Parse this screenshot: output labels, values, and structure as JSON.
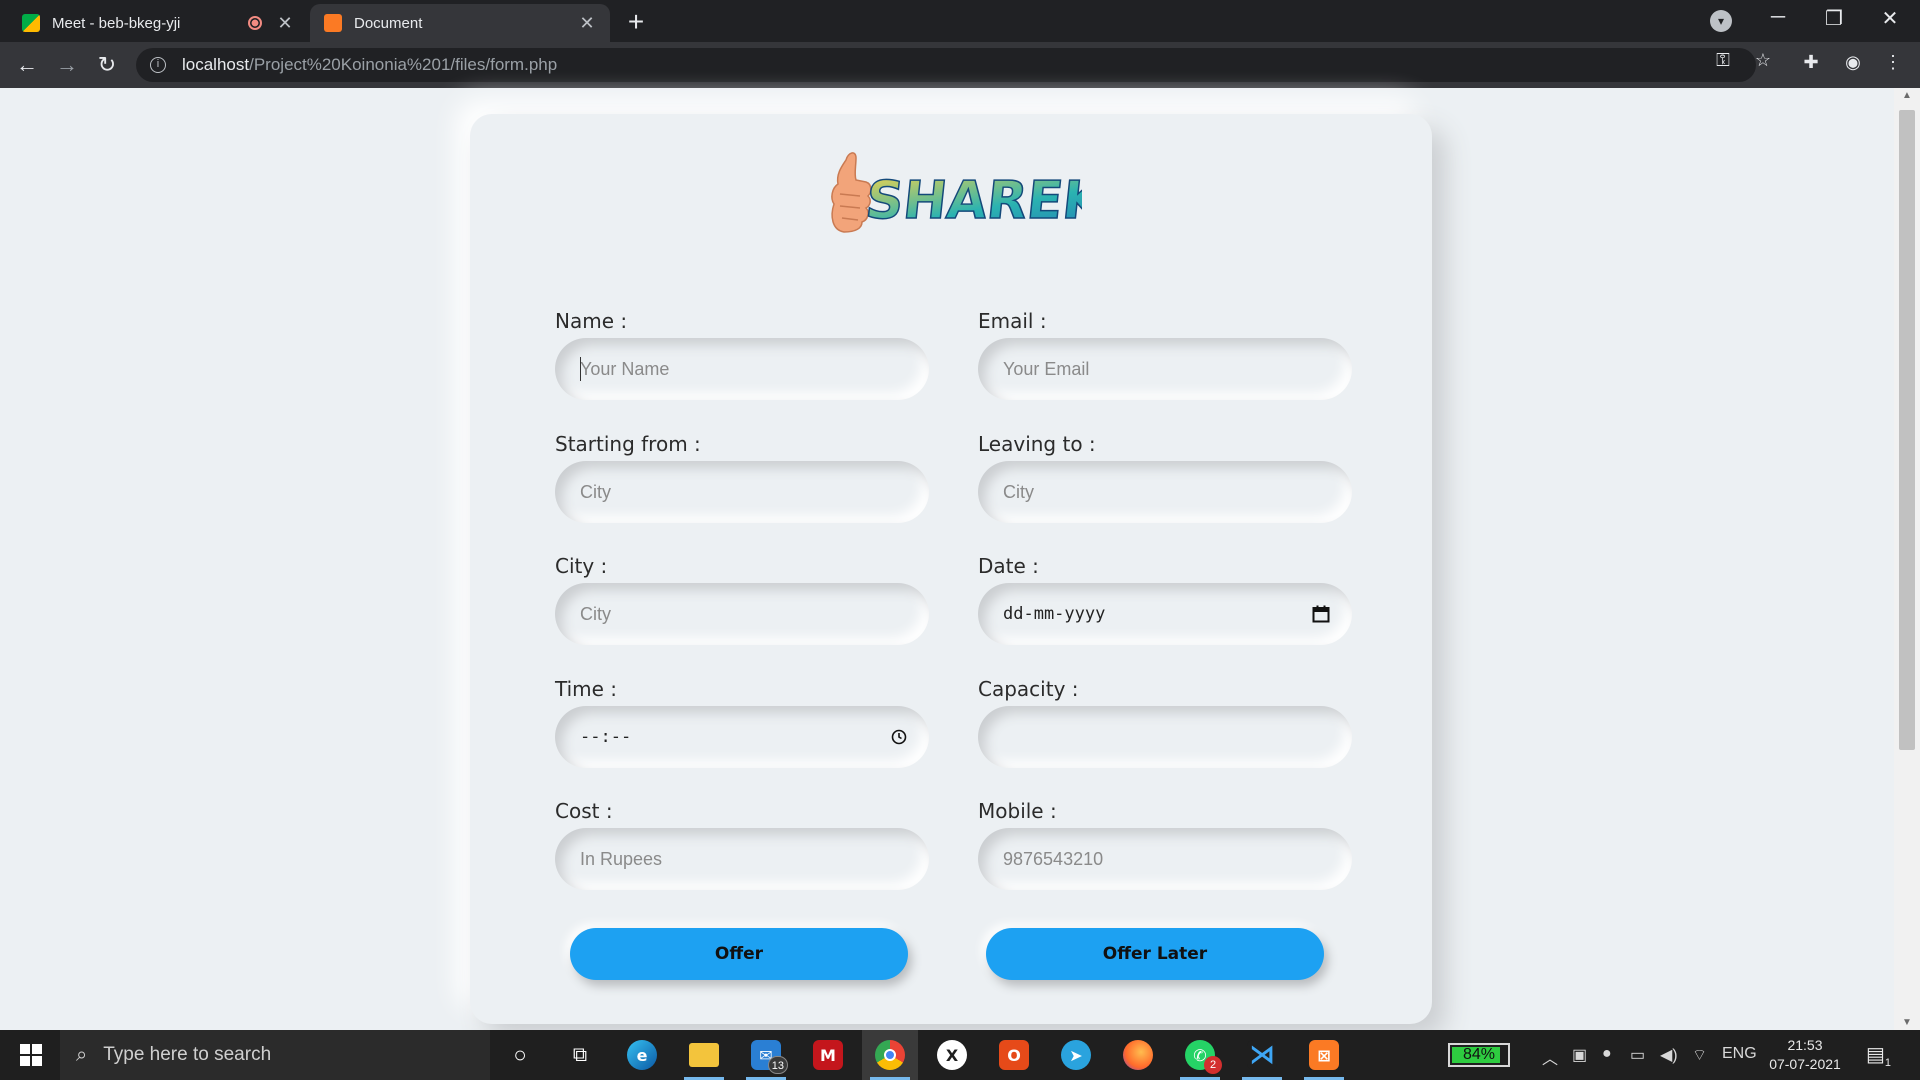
{
  "browser": {
    "tabs": [
      {
        "title": "Meet - beb-bkeg-yji",
        "active": false
      },
      {
        "title": "Document",
        "active": true
      }
    ],
    "url_host": "localhost",
    "url_path": "/Project%20Koinonia%201/files/form.php"
  },
  "page": {
    "logo_text": "SHAREKAR",
    "fields": {
      "name": {
        "label": "Name :",
        "placeholder": "Your Name"
      },
      "email": {
        "label": "Email :",
        "placeholder": "Your Email"
      },
      "starting_from": {
        "label": "Starting from :",
        "placeholder": "City"
      },
      "leaving_to": {
        "label": "Leaving to :",
        "placeholder": "City"
      },
      "city": {
        "label": "City :",
        "placeholder": "City"
      },
      "date": {
        "label": "Date :",
        "value": "dd-mm-yyyy"
      },
      "time": {
        "label": "Time :",
        "value": "--:--"
      },
      "capacity": {
        "label": "Capacity :",
        "placeholder": ""
      },
      "cost": {
        "label": "Cost :",
        "placeholder": "In Rupees"
      },
      "mobile": {
        "label": "Mobile :",
        "placeholder": "9876543210"
      }
    },
    "buttons": {
      "offer": "Offer",
      "offer_later": "Offer Later"
    },
    "accent_color": "#1da1f2"
  },
  "taskbar": {
    "search_placeholder": "Type here to search",
    "mail_badge": "13",
    "whatsapp_badge": "2",
    "battery": "84%",
    "language": "ENG",
    "time": "21:53",
    "date": "07-07-2021",
    "notification_count": "1"
  }
}
